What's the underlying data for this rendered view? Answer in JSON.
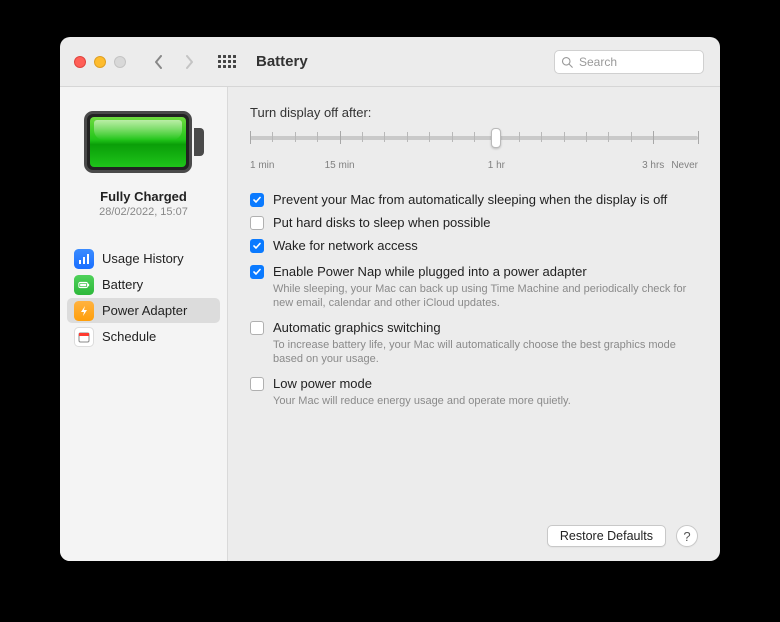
{
  "header": {
    "title": "Battery",
    "search_placeholder": "Search"
  },
  "sidebar": {
    "battery_status": "Fully Charged",
    "battery_time": "28/02/2022, 15:07",
    "items": [
      {
        "label": "Usage History"
      },
      {
        "label": "Battery"
      },
      {
        "label": "Power Adapter"
      },
      {
        "label": "Schedule"
      }
    ],
    "selected_index": 2
  },
  "main": {
    "slider_label": "Turn display off after:",
    "slider_ticks": [
      "1 min",
      "15 min",
      "1 hr",
      "3 hrs",
      "Never"
    ],
    "slider_value_label": "1 hr",
    "options": [
      {
        "label": "Prevent your Mac from automatically sleeping when the display is off",
        "checked": true,
        "desc": ""
      },
      {
        "label": "Put hard disks to sleep when possible",
        "checked": false,
        "desc": ""
      },
      {
        "label": "Wake for network access",
        "checked": true,
        "desc": ""
      },
      {
        "label": "Enable Power Nap while plugged into a power adapter",
        "checked": true,
        "desc": "While sleeping, your Mac can back up using Time Machine and periodically check for new email, calendar and other iCloud updates."
      },
      {
        "label": "Automatic graphics switching",
        "checked": false,
        "desc": "To increase battery life, your Mac will automatically choose the best graphics mode based on your usage."
      },
      {
        "label": "Low power mode",
        "checked": false,
        "desc": "Your Mac will reduce energy usage and operate more quietly."
      }
    ],
    "restore_label": "Restore Defaults",
    "help_label": "?"
  }
}
